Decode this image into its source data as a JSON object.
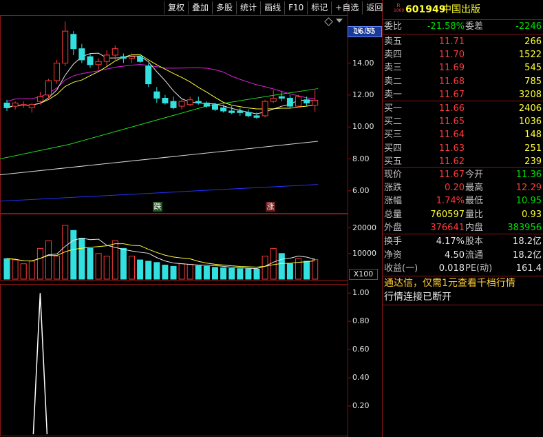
{
  "toolbar": {
    "buttons": [
      "复权",
      "叠加",
      "多股",
      "统计",
      "画线",
      "F10",
      "标记",
      "+自选",
      "返回"
    ]
  },
  "chart": {
    "current_price_tag": "16.55",
    "price_axis": [
      "16.00",
      "14.00",
      "12.00",
      "10.00",
      "8.00",
      "6.00"
    ],
    "volume_axis": [
      "20000",
      "10000"
    ],
    "volume_unit": "X100",
    "indicator_axis": [
      "1.00",
      "0.80",
      "0.60",
      "0.40",
      "0.20"
    ],
    "marker_down": "跌",
    "marker_up": "涨"
  },
  "chart_data": {
    "type": "candlestick",
    "price_ylim": [
      5,
      17
    ],
    "candles": [
      [
        11.5,
        11.7,
        11.0,
        11.2
      ],
      [
        11.3,
        11.6,
        11.1,
        11.5
      ],
      [
        11.4,
        11.6,
        11.2,
        11.4
      ],
      [
        11.2,
        11.5,
        10.9,
        11.4
      ],
      [
        11.6,
        12.2,
        11.4,
        11.9
      ],
      [
        12.0,
        13.0,
        11.8,
        12.9
      ],
      [
        12.9,
        14.2,
        12.7,
        14.0
      ],
      [
        14.0,
        16.6,
        13.8,
        16.0
      ],
      [
        15.8,
        16.0,
        14.5,
        14.9
      ],
      [
        14.9,
        15.2,
        14.0,
        14.2
      ],
      [
        14.4,
        14.6,
        13.7,
        13.9
      ],
      [
        13.9,
        14.3,
        13.6,
        14.1
      ],
      [
        14.1,
        14.8,
        13.8,
        14.5
      ],
      [
        14.5,
        15.1,
        14.2,
        14.9
      ],
      [
        14.4,
        14.6,
        14.0,
        14.3
      ],
      [
        14.3,
        14.6,
        14.0,
        14.4
      ],
      [
        14.4,
        14.5,
        14.0,
        14.1
      ],
      [
        13.8,
        14.0,
        12.5,
        12.7
      ],
      [
        12.2,
        12.5,
        11.5,
        11.8
      ],
      [
        11.8,
        12.0,
        11.4,
        11.5
      ],
      [
        11.6,
        11.9,
        11.1,
        11.2
      ],
      [
        11.3,
        11.7,
        11.1,
        11.6
      ],
      [
        11.4,
        11.9,
        11.3,
        11.7
      ],
      [
        11.6,
        11.9,
        11.4,
        11.5
      ],
      [
        11.5,
        11.6,
        11.2,
        11.3
      ],
      [
        11.4,
        11.5,
        11.0,
        11.1
      ],
      [
        11.2,
        11.4,
        10.9,
        11.0
      ],
      [
        11.0,
        11.3,
        10.8,
        10.9
      ],
      [
        11.0,
        11.2,
        10.7,
        10.9
      ],
      [
        10.9,
        11.1,
        10.6,
        10.7
      ],
      [
        10.7,
        10.9,
        10.5,
        10.6
      ],
      [
        10.7,
        11.7,
        10.6,
        11.6
      ],
      [
        11.6,
        12.3,
        11.5,
        11.8
      ],
      [
        11.9,
        12.2,
        11.6,
        11.8
      ],
      [
        11.8,
        12.0,
        11.2,
        11.3
      ],
      [
        11.3,
        12.0,
        11.2,
        11.9
      ],
      [
        11.7,
        11.9,
        11.3,
        11.5
      ],
      [
        11.36,
        12.29,
        10.95,
        11.67
      ]
    ],
    "volume_ylim": [
      0,
      25000
    ],
    "volumes": [
      8000,
      7500,
      6000,
      7000,
      12000,
      15000,
      9000,
      21000,
      19000,
      16000,
      12000,
      10000,
      9000,
      15000,
      12000,
      9000,
      7500,
      7000,
      6500,
      5500,
      5000,
      6000,
      5800,
      5200,
      5000,
      4600,
      4400,
      4200,
      4100,
      4000,
      3900,
      9000,
      12000,
      10000,
      6000,
      8000,
      7000,
      7600
    ],
    "indicator_ylim": [
      0,
      1.05
    ],
    "indicator_peak_index": 4
  },
  "panel": {
    "code": "601949",
    "name": "中国出版",
    "badge_top": "R",
    "badge_bottom": "1000",
    "wb": {
      "label": "委比",
      "value": "-21.58%",
      "label2": "委差",
      "value2": "-2246"
    },
    "asks": [
      {
        "label": "卖五",
        "price": "11.71",
        "vol": "266"
      },
      {
        "label": "卖四",
        "price": "11.70",
        "vol": "1522"
      },
      {
        "label": "卖三",
        "price": "11.69",
        "vol": "545"
      },
      {
        "label": "卖二",
        "price": "11.68",
        "vol": "785"
      },
      {
        "label": "卖一",
        "price": "11.67",
        "vol": "3208"
      }
    ],
    "bids": [
      {
        "label": "买一",
        "price": "11.66",
        "vol": "2406"
      },
      {
        "label": "买二",
        "price": "11.65",
        "vol": "1036"
      },
      {
        "label": "买三",
        "price": "11.64",
        "vol": "148"
      },
      {
        "label": "买四",
        "price": "11.63",
        "vol": "251"
      },
      {
        "label": "买五",
        "price": "11.62",
        "vol": "239"
      }
    ],
    "quote": [
      {
        "l1": "现价",
        "v1": "11.67",
        "l2": "今开",
        "v2": "11.36"
      },
      {
        "l1": "涨跌",
        "v1": "0.20",
        "l2": "最高",
        "v2": "12.29"
      },
      {
        "l1": "涨幅",
        "v1": "1.74%",
        "l2": "最低",
        "v2": "10.95"
      },
      {
        "l1": "总量",
        "v1": "760597",
        "l2": "量比",
        "v2": "0.93"
      },
      {
        "l1": "外盘",
        "v1": "376641",
        "l2": "内盘",
        "v2": "383956"
      }
    ],
    "fin": [
      {
        "l1": "换手",
        "v1": "4.17%",
        "l2": "股本",
        "v2": "18.2亿"
      },
      {
        "l1": "净资",
        "v1": "4.50",
        "l2": "流通",
        "v2": "18.2亿"
      },
      {
        "l1": "收益(一)",
        "v1": "0.018",
        "l2": "PE(动)",
        "v2": "161.4"
      }
    ],
    "promo": "通达信，仅需1元查看千档行情",
    "status": "行情连接已断开"
  }
}
